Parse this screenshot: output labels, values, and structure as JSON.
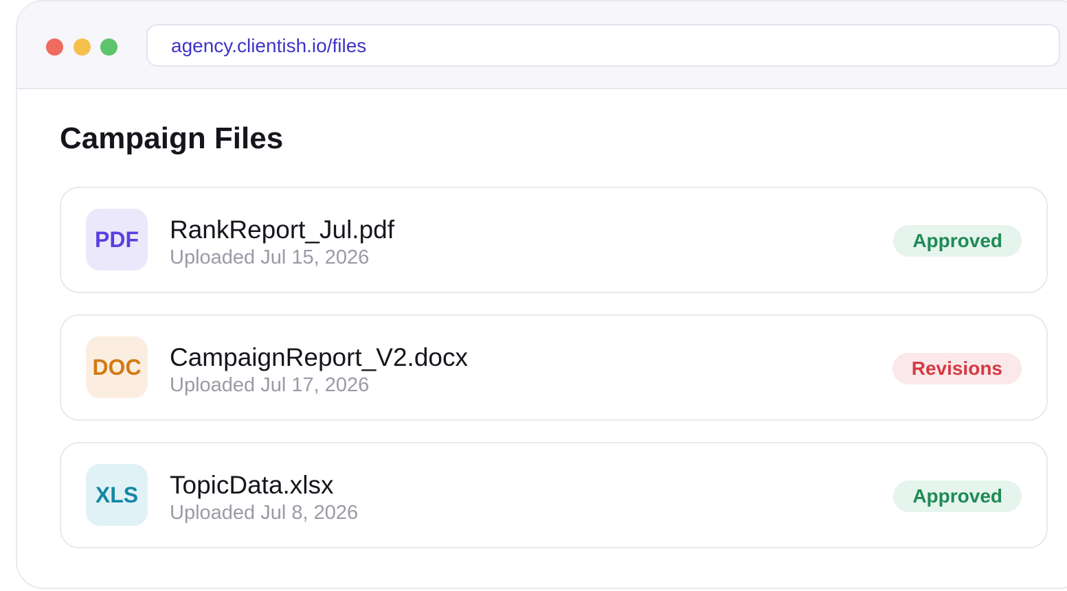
{
  "browser": {
    "url": "agency.clientish.io/files",
    "url_color": "#3f33c6",
    "dots": [
      {
        "name": "close",
        "color": "#ef6a5f"
      },
      {
        "name": "minimize",
        "color": "#f6c04a"
      },
      {
        "name": "maximize",
        "color": "#5cc46a"
      }
    ]
  },
  "page": {
    "title": "Campaign Files"
  },
  "files": [
    {
      "type_label": "PDF",
      "type_color": "#5a3fe0",
      "type_bg": "#ece8fc",
      "name": "RankReport_Jul.pdf",
      "uploaded": "Uploaded Jul 15, 2026",
      "status": "Approved",
      "status_color": "#1f8a55",
      "status_bg": "#e5f4ec"
    },
    {
      "type_label": "DOC",
      "type_color": "#d37a12",
      "type_bg": "#fbeee1",
      "name": "CampaignReport_V2.docx",
      "uploaded": "Uploaded Jul 17, 2026",
      "status": "Revisions",
      "status_color": "#d43a42",
      "status_bg": "#fbe8ea"
    },
    {
      "type_label": "XLS",
      "type_color": "#1487a6",
      "type_bg": "#e1f2f6",
      "name": "TopicData.xlsx",
      "uploaded": "Uploaded Jul 8, 2026",
      "status": "Approved",
      "status_color": "#1f8a55",
      "status_bg": "#e5f4ec"
    }
  ]
}
